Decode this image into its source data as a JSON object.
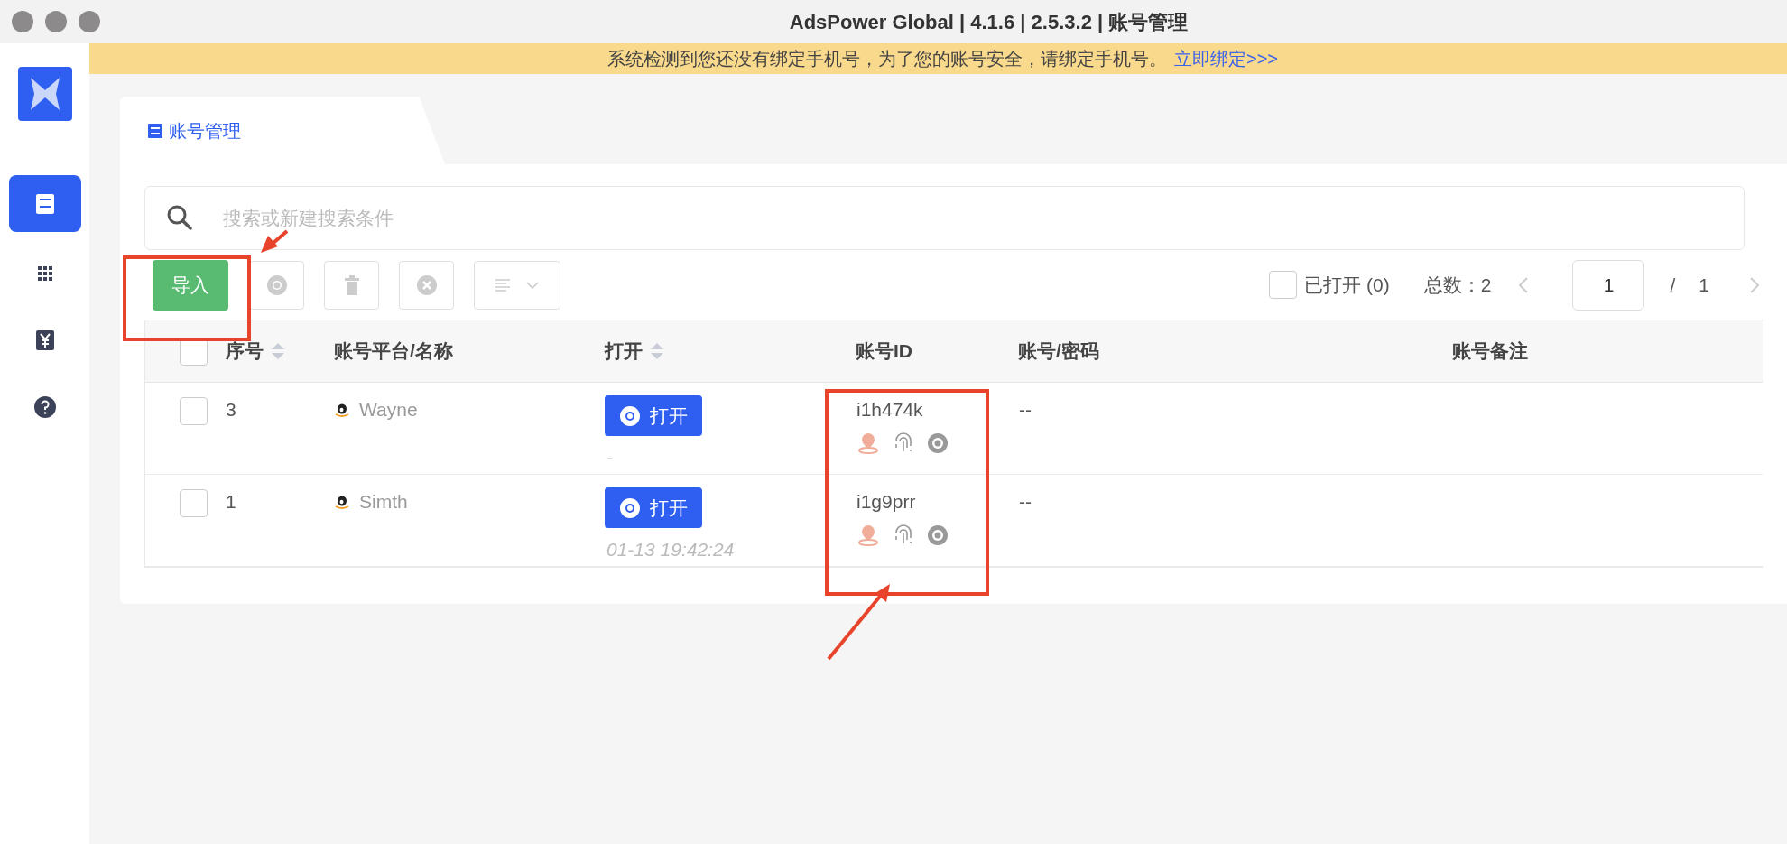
{
  "window": {
    "title": "AdsPower Global | 4.1.6 | 2.5.3.2 | 账号管理"
  },
  "banner": {
    "text": "系统检测到您还没有绑定手机号，为了您的账号安全，请绑定手机号。",
    "link": "立即绑定>>>"
  },
  "sidebar": {
    "items": [
      {
        "kind": "list",
        "selected": true
      },
      {
        "kind": "apps",
        "selected": false
      },
      {
        "kind": "yen",
        "selected": false
      },
      {
        "kind": "help",
        "selected": false
      }
    ]
  },
  "tab": {
    "label": "账号管理"
  },
  "search": {
    "placeholder": "搜索或新建搜索条件"
  },
  "toolbar": {
    "import_button": "导入",
    "opened_filter": {
      "label": "已打开 (0)",
      "checked": false
    },
    "total": "总数：2",
    "pagination": {
      "page": "1",
      "separator": "/",
      "pages": "1"
    }
  },
  "table": {
    "select_all": {
      "checked": false
    },
    "columns": [
      {
        "label": "序号",
        "sortable": true
      },
      {
        "label": "账号平台/名称",
        "sortable": false
      },
      {
        "label": "打开",
        "sortable": true
      },
      {
        "label": "账号ID",
        "sortable": false
      },
      {
        "label": "账号/密码",
        "sortable": false
      },
      {
        "label": "账号备注",
        "sortable": false
      }
    ],
    "rows": [
      {
        "checked": false,
        "index": "3",
        "name": "Wayne",
        "open_button": "打开",
        "last_opened": "-",
        "account_id": "i1h474k",
        "credentials": "--"
      },
      {
        "checked": false,
        "index": "1",
        "name": "Simth",
        "open_button": "打开",
        "last_opened": "01-13 19:42:24",
        "account_id": "i1g9prr",
        "credentials": "--"
      }
    ]
  }
}
